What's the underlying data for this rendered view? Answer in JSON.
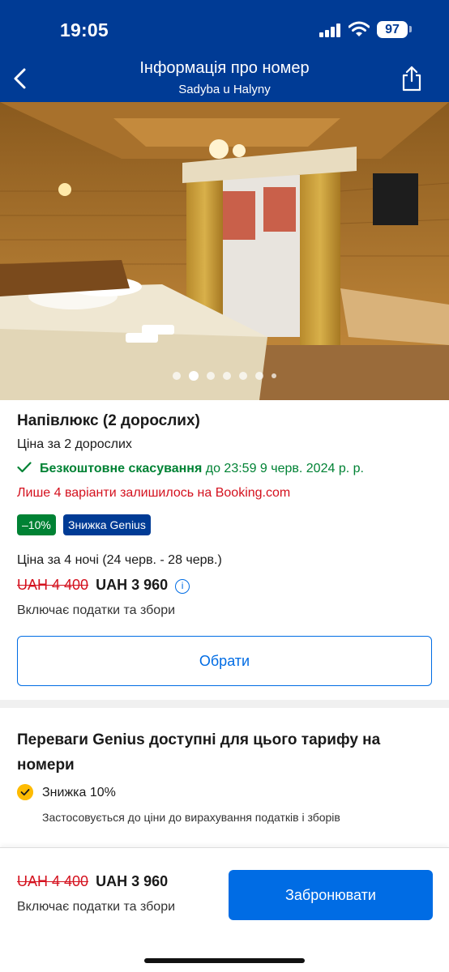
{
  "status_bar": {
    "time": "19:05",
    "battery": "97"
  },
  "header": {
    "title": "Інформація про номер",
    "subtitle": "Sadyba u Halyny",
    "back_icon": "chevron-left-icon",
    "share_icon": "share-icon"
  },
  "gallery": {
    "photo_count": 7,
    "active_index": 1
  },
  "room": {
    "title": "Напівлюкс (2 дорослих)",
    "price_for": "Ціна за 2 дорослих",
    "free_cancellation_label": "Безкоштовне скасування",
    "free_cancellation_until": " до 23:59 9 черв. 2024 р. р.",
    "scarcity": "Лише 4 варіанти залишилось на Booking.com",
    "discount_badge": "–10%",
    "genius_badge": "Знижка Genius",
    "nights_price": "Ціна за 4 ночі (24 черв. - 28 черв.)",
    "old_price": "UAH 4 400",
    "new_price": "UAH 3 960",
    "taxes_note": "Включає податки та збори",
    "select_button": "Обрати"
  },
  "genius": {
    "title": "Переваги Genius доступні для цього тарифу на номери",
    "benefit_title": "Знижка 10%",
    "benefit_desc": "Застосовується до ціни до вирахування податків і зборів"
  },
  "bottom_bar": {
    "old_price": "UAH 4 400",
    "new_price": "UAH 3 960",
    "taxes_note": "Включає податки та збори",
    "book_button": "Забронювати"
  },
  "colors": {
    "brand_blue": "#003b95",
    "action_blue": "#006ce4",
    "success_green": "#008234",
    "alert_red": "#d4111e",
    "genius_yellow": "#febb02"
  }
}
